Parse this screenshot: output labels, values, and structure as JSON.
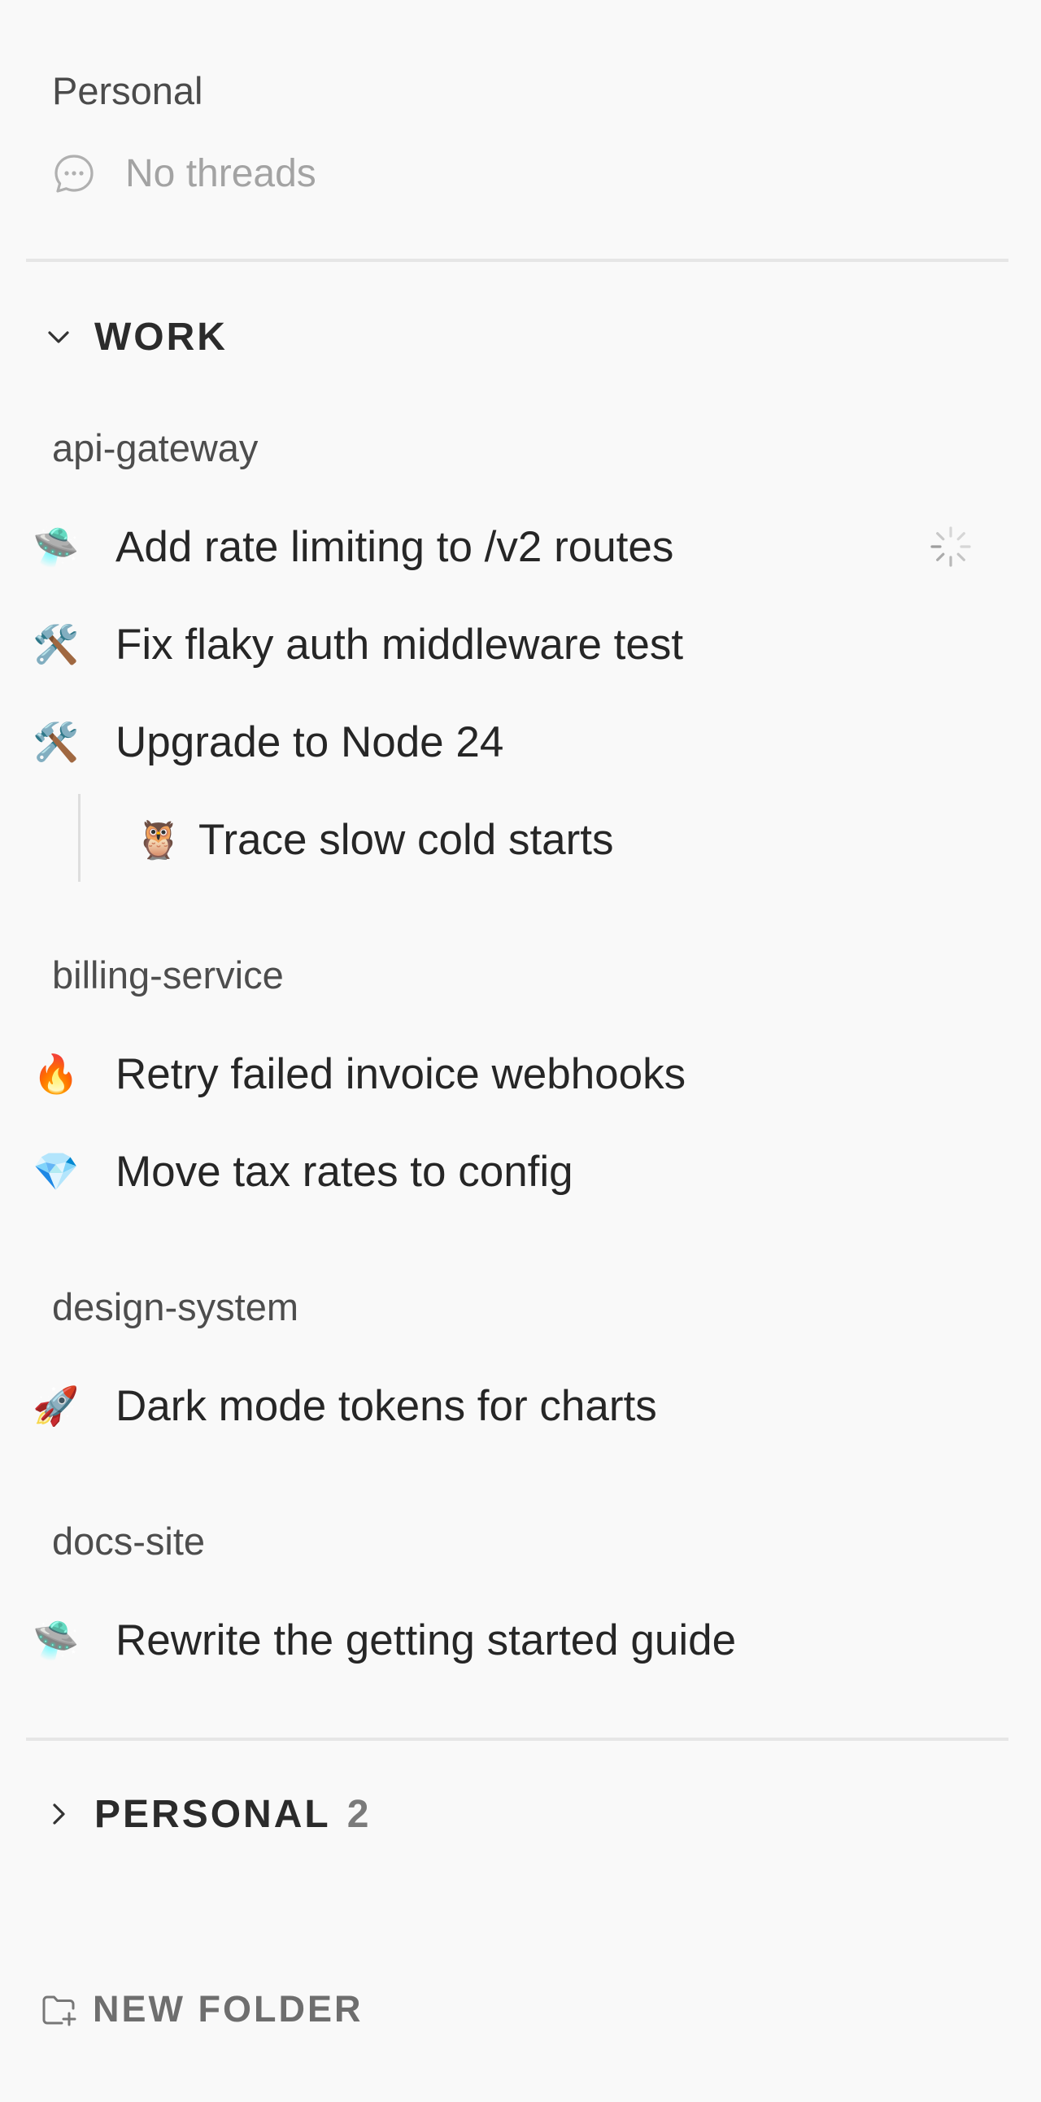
{
  "personal_pinned": {
    "title": "Personal",
    "empty_icon": "chat-bubble-icon",
    "empty_text": "No threads"
  },
  "work": {
    "label": "WORK",
    "toggle_icon": "chevron-down-icon",
    "projects": [
      {
        "name": "api-gateway",
        "threads": [
          {
            "emoji": "🛸",
            "emoji_name": "flying-saucer-icon",
            "title": "Add rate limiting to /v2 routes",
            "status": "loading"
          },
          {
            "emoji": "🛠️",
            "emoji_name": "tools-icon",
            "title": "Fix flaky auth middleware test"
          },
          {
            "emoji": "🛠️",
            "emoji_name": "tools-icon",
            "title": "Upgrade to Node 24"
          },
          {
            "emoji": "🦉",
            "emoji_name": "owl-icon",
            "title": "Trace slow cold starts",
            "child": true
          }
        ]
      },
      {
        "name": "billing-service",
        "threads": [
          {
            "emoji": "🔥",
            "emoji_name": "fire-icon",
            "title": "Retry failed invoice webhooks"
          },
          {
            "emoji": "💎",
            "emoji_name": "gem-icon",
            "title": "Move tax rates to config"
          }
        ]
      },
      {
        "name": "design-system",
        "threads": [
          {
            "emoji": "🚀",
            "emoji_name": "rocket-icon",
            "title": "Dark mode tokens for charts"
          }
        ]
      },
      {
        "name": "docs-site",
        "threads": [
          {
            "emoji": "🛸",
            "emoji_name": "flying-saucer-icon",
            "title": "Rewrite the getting started guide"
          }
        ]
      }
    ]
  },
  "personal_section": {
    "label": "PERSONAL",
    "count": "2",
    "toggle_icon": "chevron-right-icon"
  },
  "new_folder": {
    "label": "NEW FOLDER",
    "icon": "folder-plus-icon"
  },
  "colors": {
    "background": "#f9f9f9",
    "text": "#262626",
    "muted": "#a3a3a3",
    "divider": "#e6e6e6"
  }
}
